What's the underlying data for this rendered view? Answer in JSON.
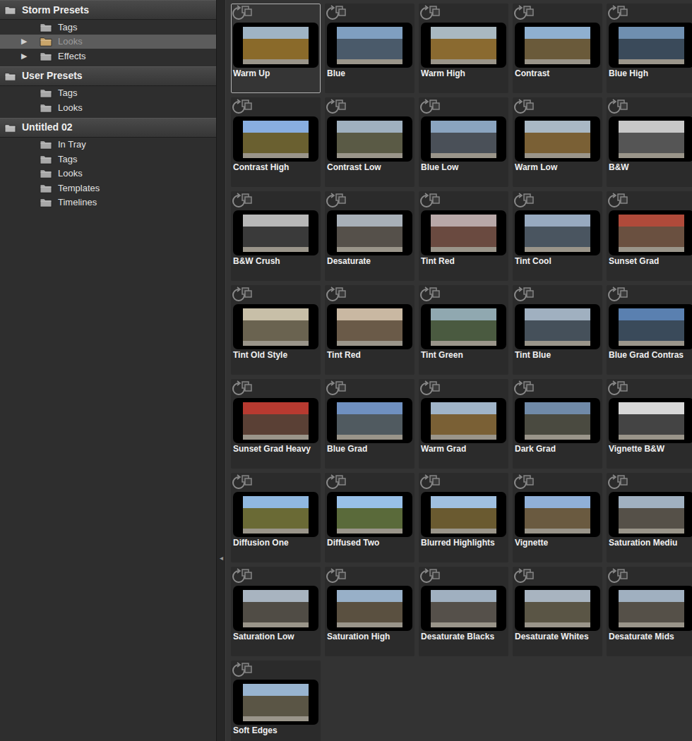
{
  "sidebar": {
    "sections": [
      {
        "title": "Storm Presets",
        "items": [
          {
            "label": "Tags",
            "arrow": "",
            "selected": false
          },
          {
            "label": "Looks",
            "arrow": "▶",
            "selected": true
          },
          {
            "label": "Effects",
            "arrow": "▶",
            "selected": false
          }
        ]
      },
      {
        "title": "User Presets",
        "items": [
          {
            "label": "Tags",
            "arrow": "",
            "selected": false
          },
          {
            "label": "Looks",
            "arrow": "",
            "selected": false
          }
        ]
      },
      {
        "title": "Untitled 02",
        "items": [
          {
            "label": "In Tray",
            "arrow": "",
            "selected": false
          },
          {
            "label": "Tags",
            "arrow": "",
            "selected": false
          },
          {
            "label": "Looks",
            "arrow": "",
            "selected": false
          },
          {
            "label": "Templates",
            "arrow": "",
            "selected": false
          },
          {
            "label": "Timelines",
            "arrow": "",
            "selected": false
          }
        ]
      }
    ]
  },
  "splitter": {
    "arrow": "◂"
  },
  "presets": [
    {
      "label": "Warm Up",
      "selected": true,
      "sky_color": "#9fb4c4",
      "color": "#8a6a2a"
    },
    {
      "label": "Blue",
      "selected": false,
      "sky_color": "#7f9fc0",
      "color": "#4a5a6a"
    },
    {
      "label": "Warm High",
      "selected": false,
      "sky_color": "#a9b8c0",
      "color": "#8a6a30"
    },
    {
      "label": "Contrast",
      "selected": false,
      "sky_color": "#8fb0d0",
      "color": "#6a5a3a"
    },
    {
      "label": "Blue High",
      "selected": false,
      "sky_color": "#6f8fb0",
      "color": "#3a4a5a"
    },
    {
      "label": "Contrast High",
      "selected": false,
      "sky_color": "#88aee0",
      "color": "#6a6030"
    },
    {
      "label": "Contrast Low",
      "selected": false,
      "sky_color": "#9fb0bf",
      "color": "#5a5a45"
    },
    {
      "label": "Blue Low",
      "selected": false,
      "sky_color": "#8aa4bf",
      "color": "#4a5058"
    },
    {
      "label": "Warm Low",
      "selected": false,
      "sky_color": "#a9b8c4",
      "color": "#7a6035"
    },
    {
      "label": "B&W",
      "selected": false,
      "sky_color": "#c8c8c8",
      "color": "#555555"
    },
    {
      "label": "B&W Crush",
      "selected": false,
      "sky_color": "#b8b8b8",
      "color": "#3a3a3a"
    },
    {
      "label": "Desaturate",
      "selected": false,
      "sky_color": "#a8b0b8",
      "color": "#55504a"
    },
    {
      "label": "Tint Red",
      "selected": false,
      "sky_color": "#b8a8a8",
      "color": "#6a4a40"
    },
    {
      "label": "Tint Cool",
      "selected": false,
      "sky_color": "#98aac0",
      "color": "#4a5560"
    },
    {
      "label": "Sunset Grad",
      "selected": false,
      "sky_color": "#b04a3a",
      "color": "#6a5040"
    },
    {
      "label": "Tint Old Style",
      "selected": false,
      "sky_color": "#c8bfa8",
      "color": "#6a6350"
    },
    {
      "label": "Tint Red",
      "selected": false,
      "sky_color": "#c9b8a2",
      "color": "#6a5a48"
    },
    {
      "label": "Tint Green",
      "selected": false,
      "sky_color": "#90a8b0",
      "color": "#4a5a40"
    },
    {
      "label": "Tint Blue",
      "selected": false,
      "sky_color": "#a0b0c0",
      "color": "#45505a"
    },
    {
      "label": "Blue Grad Contras",
      "selected": false,
      "sky_color": "#5a80b0",
      "color": "#3a4a5a"
    },
    {
      "label": "Sunset Grad Heavy",
      "selected": false,
      "sky_color": "#b83a30",
      "color": "#5a4035"
    },
    {
      "label": "Blue Grad",
      "selected": false,
      "sky_color": "#6f90c0",
      "color": "#505a60"
    },
    {
      "label": "Warm Grad",
      "selected": false,
      "sky_color": "#a0b4c8",
      "color": "#7a6035"
    },
    {
      "label": "Dark Grad",
      "selected": false,
      "sky_color": "#708aa8",
      "color": "#4a4a40"
    },
    {
      "label": "Vignette B&W",
      "selected": false,
      "sky_color": "#d8d8d8",
      "color": "#444444"
    },
    {
      "label": "Diffusion One",
      "selected": false,
      "sky_color": "#90b8e0",
      "color": "#6a6a35"
    },
    {
      "label": "Diffused Two",
      "selected": false,
      "sky_color": "#98c0e8",
      "color": "#5a6a3a"
    },
    {
      "label": "Blurred Highlights",
      "selected": false,
      "sky_color": "#a0c0e0",
      "color": "#6a5a30"
    },
    {
      "label": "Vignette",
      "selected": false,
      "sky_color": "#90b0d8",
      "color": "#6a5a40"
    },
    {
      "label": "Saturation Mediu",
      "selected": false,
      "sky_color": "#a0b0c0",
      "color": "#555048"
    },
    {
      "label": "Saturation Low",
      "selected": false,
      "sky_color": "#a8b4c0",
      "color": "#504c45"
    },
    {
      "label": "Saturation High",
      "selected": false,
      "sky_color": "#98b0c8",
      "color": "#5a5040"
    },
    {
      "label": "Desaturate Blacks",
      "selected": false,
      "sky_color": "#a0b0c0",
      "color": "#55504a"
    },
    {
      "label": "Desaturate Whites",
      "selected": false,
      "sky_color": "#a8b4c0",
      "color": "#5a5545"
    },
    {
      "label": "Desaturate Mids",
      "selected": false,
      "sky_color": "#a0b0c0",
      "color": "#555048"
    },
    {
      "label": "Soft Edges",
      "selected": false,
      "sky_color": "#98b4d0",
      "color": "#5a5545"
    }
  ]
}
